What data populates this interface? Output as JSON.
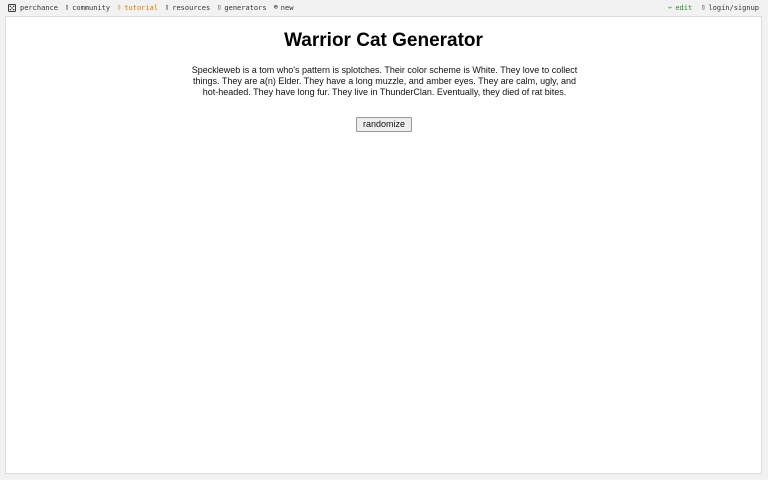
{
  "nav": {
    "brand": "perchance",
    "items": [
      {
        "label": "community",
        "icon": "community-icon"
      },
      {
        "label": "tutorial",
        "icon": "tutorial-icon"
      },
      {
        "label": "resources",
        "icon": "resources-icon"
      },
      {
        "label": "generators",
        "icon": "generators-icon"
      },
      {
        "label": "new",
        "icon": "plus-circle-icon"
      }
    ],
    "right": [
      {
        "label": "edit",
        "icon": "pencil-icon"
      },
      {
        "label": "login/signup",
        "icon": "user-icon"
      }
    ]
  },
  "colors": {
    "tutorial": "#e07800",
    "edit": "#2a8a2a",
    "card_bg": "#ffffff",
    "page_bg": "#f2f2f2"
  },
  "main": {
    "title": "Warrior Cat Generator",
    "description": "Speckleweb is a tom who's pattern is splotches. Their color scheme is White. They love to collect things. They are a(n) Elder. They have a long muzzle, and amber eyes. They are calm, ugly, and hot-headed. They have long fur. They live in ThunderClan. Eventually, they died of rat bites.",
    "button_label": "randomize"
  }
}
